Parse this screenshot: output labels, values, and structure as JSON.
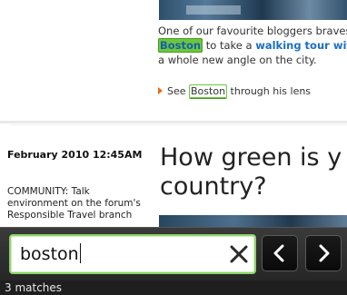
{
  "article_top": {
    "line1": "One of our favourite bloggers braves",
    "highlight_active": "Boston",
    "line2_middle": " to take a ",
    "link_text": "walking tour with",
    "line3": "a whole new angle on the city.",
    "see_prefix": "See ",
    "highlight_passive": "Boston",
    "see_suffix": " through his lens"
  },
  "article_second": {
    "date": "February 2010 12:45AM",
    "side_lines": [
      "COMMUNITY: Talk",
      "environment on the forum's",
      "Responsible Travel branch"
    ],
    "headline_line1": "How green is y",
    "headline_line2": "country?"
  },
  "find_bar": {
    "query": "boston",
    "clear_icon": "close-x-icon",
    "prev_icon": "chevron-left-icon",
    "next_icon": "chevron-right-icon"
  },
  "status": {
    "matches_text": "3 matches"
  },
  "colors": {
    "highlight": "#6cc73d",
    "link": "#1a70c0",
    "find_border": "#8fd26a"
  }
}
